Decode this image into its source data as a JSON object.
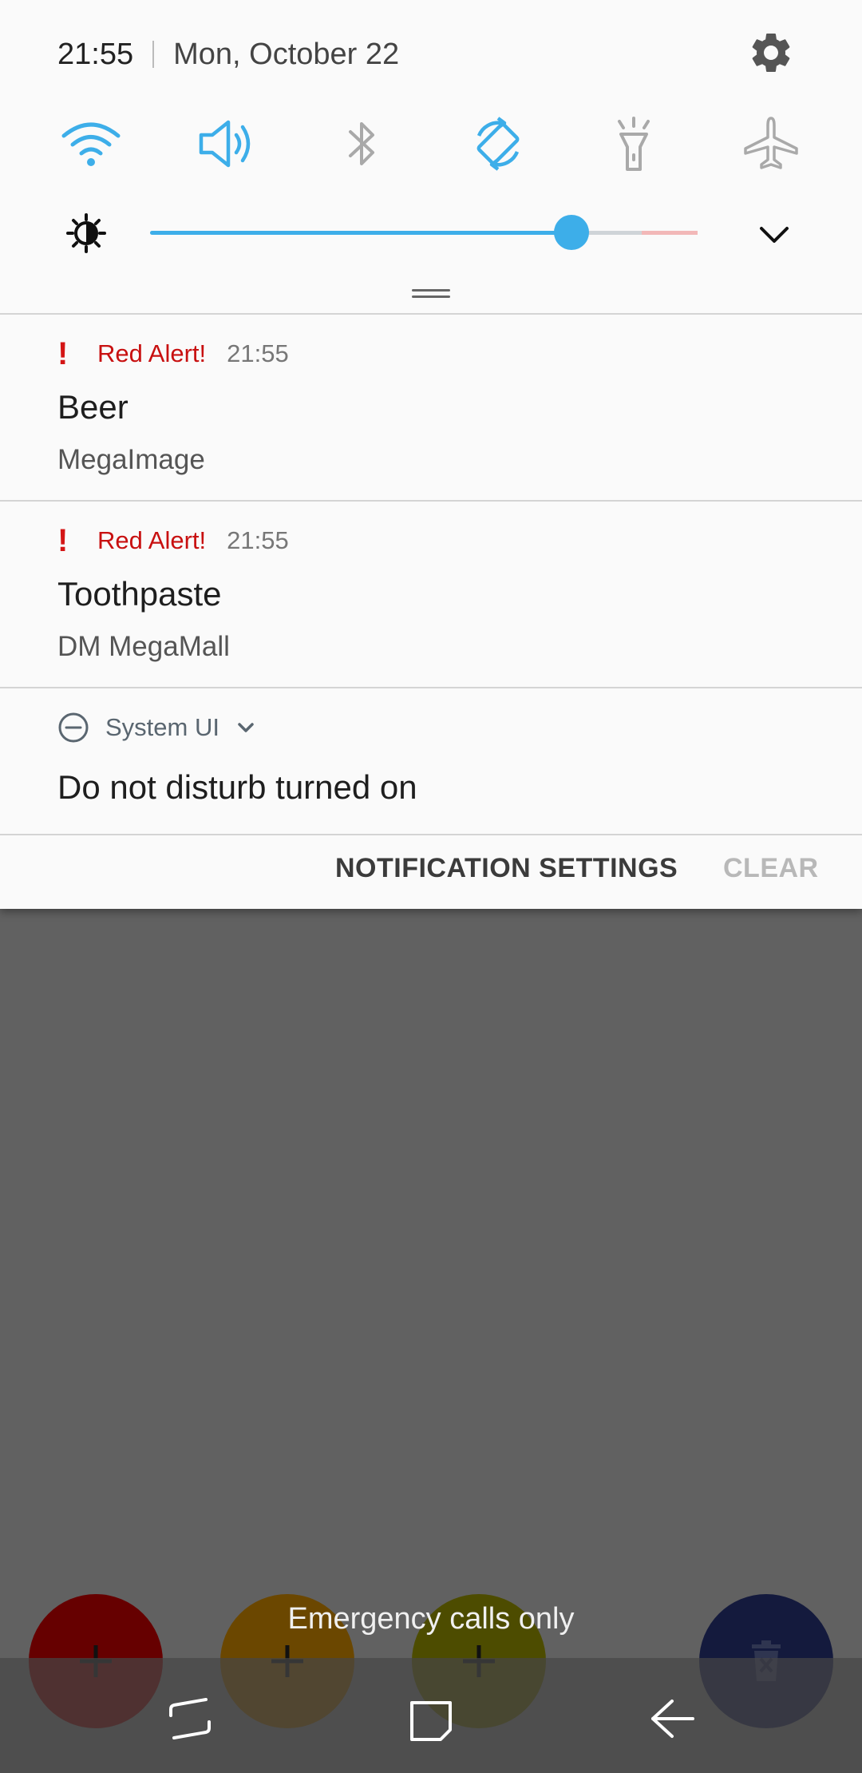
{
  "status": {
    "time": "21:55",
    "date": "Mon, October 22"
  },
  "quick_settings": [
    {
      "name": "wifi",
      "icon": "wifi-icon",
      "active": true
    },
    {
      "name": "sound",
      "icon": "speaker-icon",
      "active": true
    },
    {
      "name": "bluetooth",
      "icon": "bluetooth-icon",
      "active": false
    },
    {
      "name": "auto-rotate",
      "icon": "auto-rotate-icon",
      "active": true
    },
    {
      "name": "flashlight",
      "icon": "flashlight-icon",
      "active": false
    },
    {
      "name": "airplane-mode",
      "icon": "airplane-icon",
      "active": false
    }
  ],
  "brightness": {
    "level": 0.77
  },
  "notifications": [
    {
      "app": "Red Alert!",
      "time": "21:55",
      "title": "Beer",
      "text": "MegaImage"
    },
    {
      "app": "Red Alert!",
      "time": "21:55",
      "title": "Toothpaste",
      "text": "DM MegaMall"
    }
  ],
  "system_notification": {
    "app": "System UI",
    "title": "Do not disturb turned on"
  },
  "actions": {
    "settings_label": "NOTIFICATION SETTINGS",
    "clear_label": "CLEAR"
  },
  "emergency_text": "Emergency calls only",
  "colors": {
    "accent": "#3daee9",
    "alert_red": "#c81010",
    "fab_red": "#660000",
    "fab_orange": "#6b4700",
    "fab_olive": "#4d4c00",
    "fab_navy": "#141a3d"
  }
}
